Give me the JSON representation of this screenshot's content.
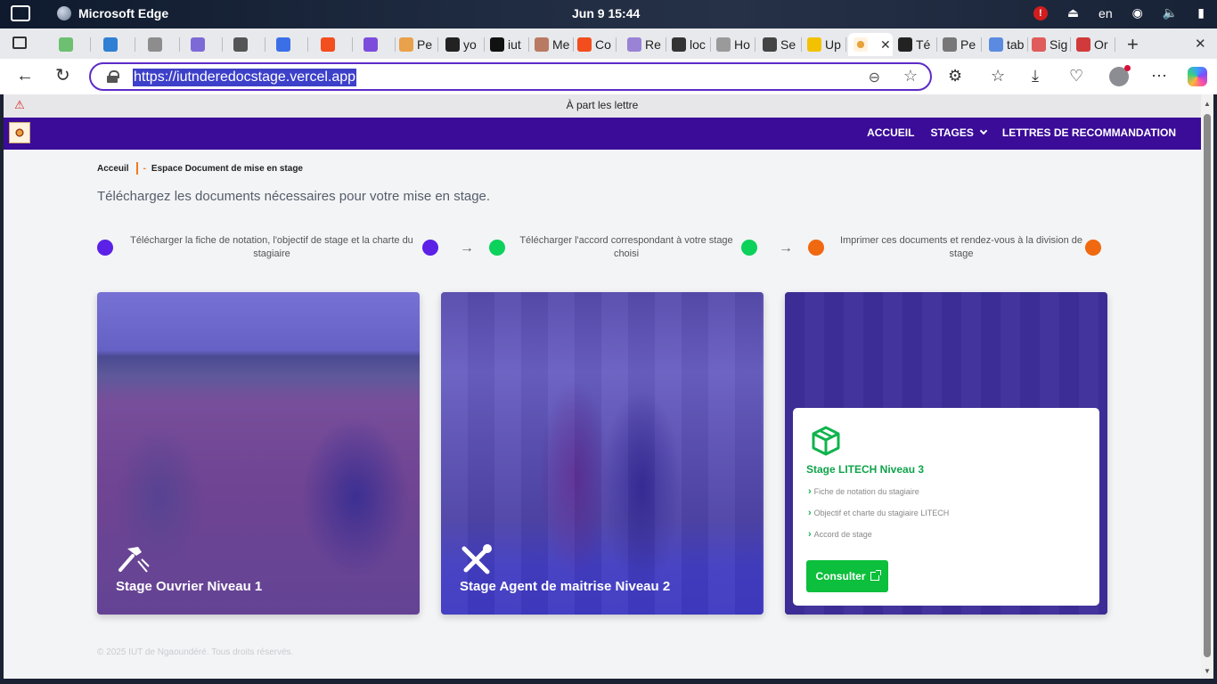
{
  "os": {
    "app_name": "Microsoft Edge",
    "clock": "Jun 9  15:44",
    "lang": "en"
  },
  "tabs": [
    {
      "label": "",
      "color": "#6cc070"
    },
    {
      "label": "",
      "color": "#2f7fd4"
    },
    {
      "label": "",
      "color": "#8d8d8d"
    },
    {
      "label": "",
      "color": "#7e6ad6"
    },
    {
      "label": "",
      "color": "#555555"
    },
    {
      "label": "",
      "color": "#3b6fe8"
    },
    {
      "label": "",
      "color": "#f24e1e"
    },
    {
      "label": "",
      "color": "#7c4ddb"
    },
    {
      "label": "Pe",
      "color": "#e9a14b"
    },
    {
      "label": "yo",
      "color": "#222222"
    },
    {
      "label": "iut",
      "color": "#111111"
    },
    {
      "label": "Me",
      "color": "#b97a63"
    },
    {
      "label": "Co",
      "color": "#f24e1e"
    },
    {
      "label": "Re",
      "color": "#9a82d6"
    },
    {
      "label": "loc",
      "color": "#333333"
    },
    {
      "label": "Ho",
      "color": "#9a9a9a"
    },
    {
      "label": "Se",
      "color": "#444444"
    },
    {
      "label": "Up",
      "color": "#f2c200"
    },
    {
      "label": "Té",
      "color": "#222222"
    },
    {
      "label": "Pe",
      "color": "#777777"
    },
    {
      "label": "tab",
      "color": "#5b8be0"
    },
    {
      "label": "Sig",
      "color": "#e05b5b"
    },
    {
      "label": "Or",
      "color": "#d03a3a"
    }
  ],
  "address_bar": {
    "url": "https://iutnderedocstage.vercel.app"
  },
  "banner": {
    "text": "À part les lettre"
  },
  "site_nav": {
    "home": "ACCUEIL",
    "stages": "STAGES",
    "letters": "LETTRES DE RECOMMANDATION"
  },
  "breadcrumb": {
    "home": "Acceuil",
    "current": "Espace Document de mise en stage"
  },
  "lead": "Téléchargez les documents nécessaires pour votre mise en stage.",
  "steps": [
    {
      "text": "Télécharger la fiche de notation, l'objectif de stage et la charte du stagiaire",
      "color": "#5b21e6"
    },
    {
      "text": "Télécharger l'accord correspondant à votre stage choisi",
      "color": "#0cd15a"
    },
    {
      "text": "Imprimer ces documents et rendez-vous à la division de stage",
      "color": "#f0680f"
    }
  ],
  "cards": [
    {
      "title": "Stage Ouvrier Niveau 1",
      "icon": "hammer-icon"
    },
    {
      "title": "Stage Agent de maitrise Niveau 2",
      "icon": "tools-icon"
    },
    {
      "title": "Stage LITECH Niveau 3",
      "icon": "cube-icon",
      "items": [
        "Fiche de notation du stagiaire",
        "Objectif et charte du stagiaire LITECH",
        "Accord de stage"
      ],
      "button": "Consulter"
    }
  ],
  "footer": "© 2025 IUT de Ngaoundéré. Tous droits réservés."
}
